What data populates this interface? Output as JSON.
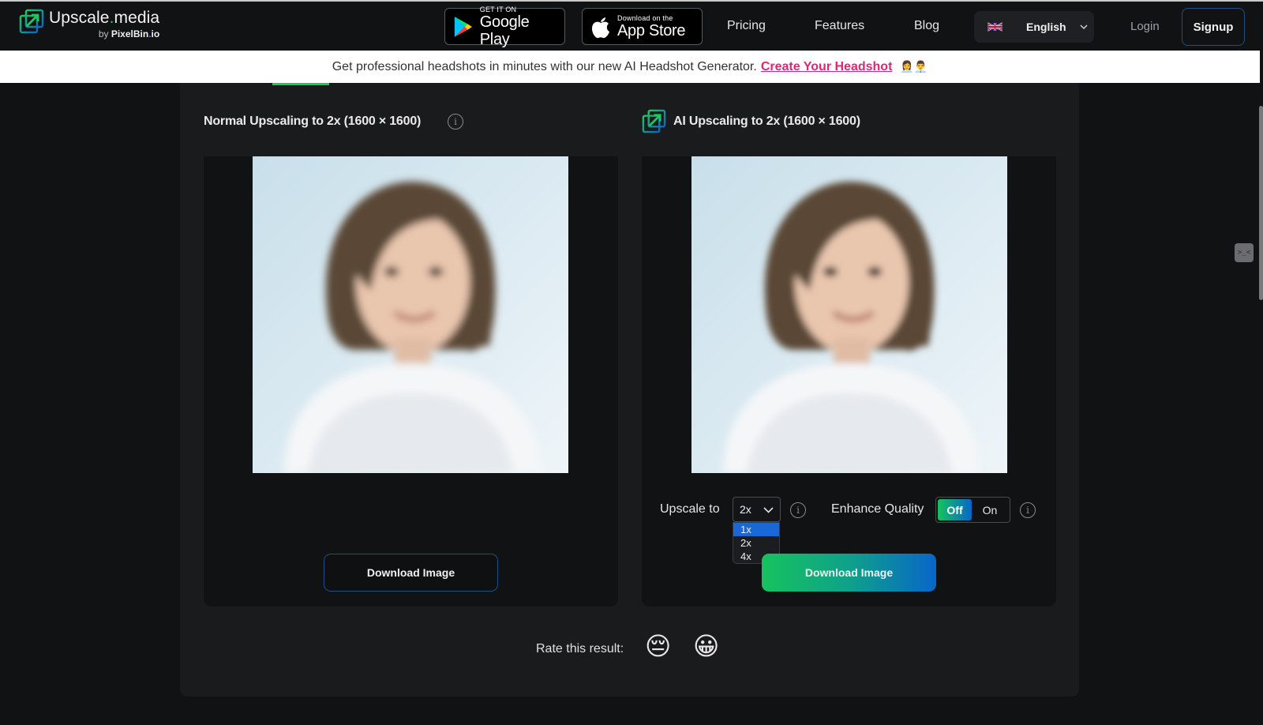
{
  "header": {
    "logo": {
      "title_part1": "Upscale",
      "title_dot": ".",
      "title_part2": "media",
      "sub_by": "by ",
      "sub_brand1": "PixelBin",
      "sub_dot": ".",
      "sub_brand2": "io"
    },
    "google_play": {
      "small": "GET IT ON",
      "big": "Google Play"
    },
    "app_store": {
      "small": "Download on the",
      "big": "App Store"
    },
    "nav": [
      {
        "label": "Pricing"
      },
      {
        "label": "Features"
      },
      {
        "label": "Blog"
      }
    ],
    "language": {
      "label": "English",
      "flag": "uk-flag"
    },
    "login_label": "Login",
    "signup_label": "Signup"
  },
  "banner": {
    "text": "Get professional headshots in minutes with our new AI Headshot Generator.",
    "link_label": "Create Your Headshot",
    "emoji": "👩‍💼👨‍💼"
  },
  "comparison": {
    "normal": {
      "title": "Normal Upscaling to 2x (1600 × 1600)",
      "download_label": "Download Image"
    },
    "ai": {
      "title": "AI Upscaling to 2x (1600 × 1600)",
      "download_label": "Download Image"
    }
  },
  "controls": {
    "upscale_label": "Upscale to",
    "upscale_value": "2x",
    "upscale_options": [
      "1x",
      "2x",
      "4x"
    ],
    "upscale_highlighted": "1x",
    "enhance_label": "Enhance Quality",
    "enhance_off": "Off",
    "enhance_on": "On",
    "enhance_state": "Off"
  },
  "rating": {
    "label": "Rate this result:",
    "sad_emoji": "😔",
    "happy_emoji": "😀"
  },
  "side_widget_glyph": ">_<",
  "colors": {
    "accent_green": "#22c55e",
    "accent_blue": "#0866c9",
    "banner_link": "#db2777",
    "dropdown_highlight": "#1a68d6"
  }
}
